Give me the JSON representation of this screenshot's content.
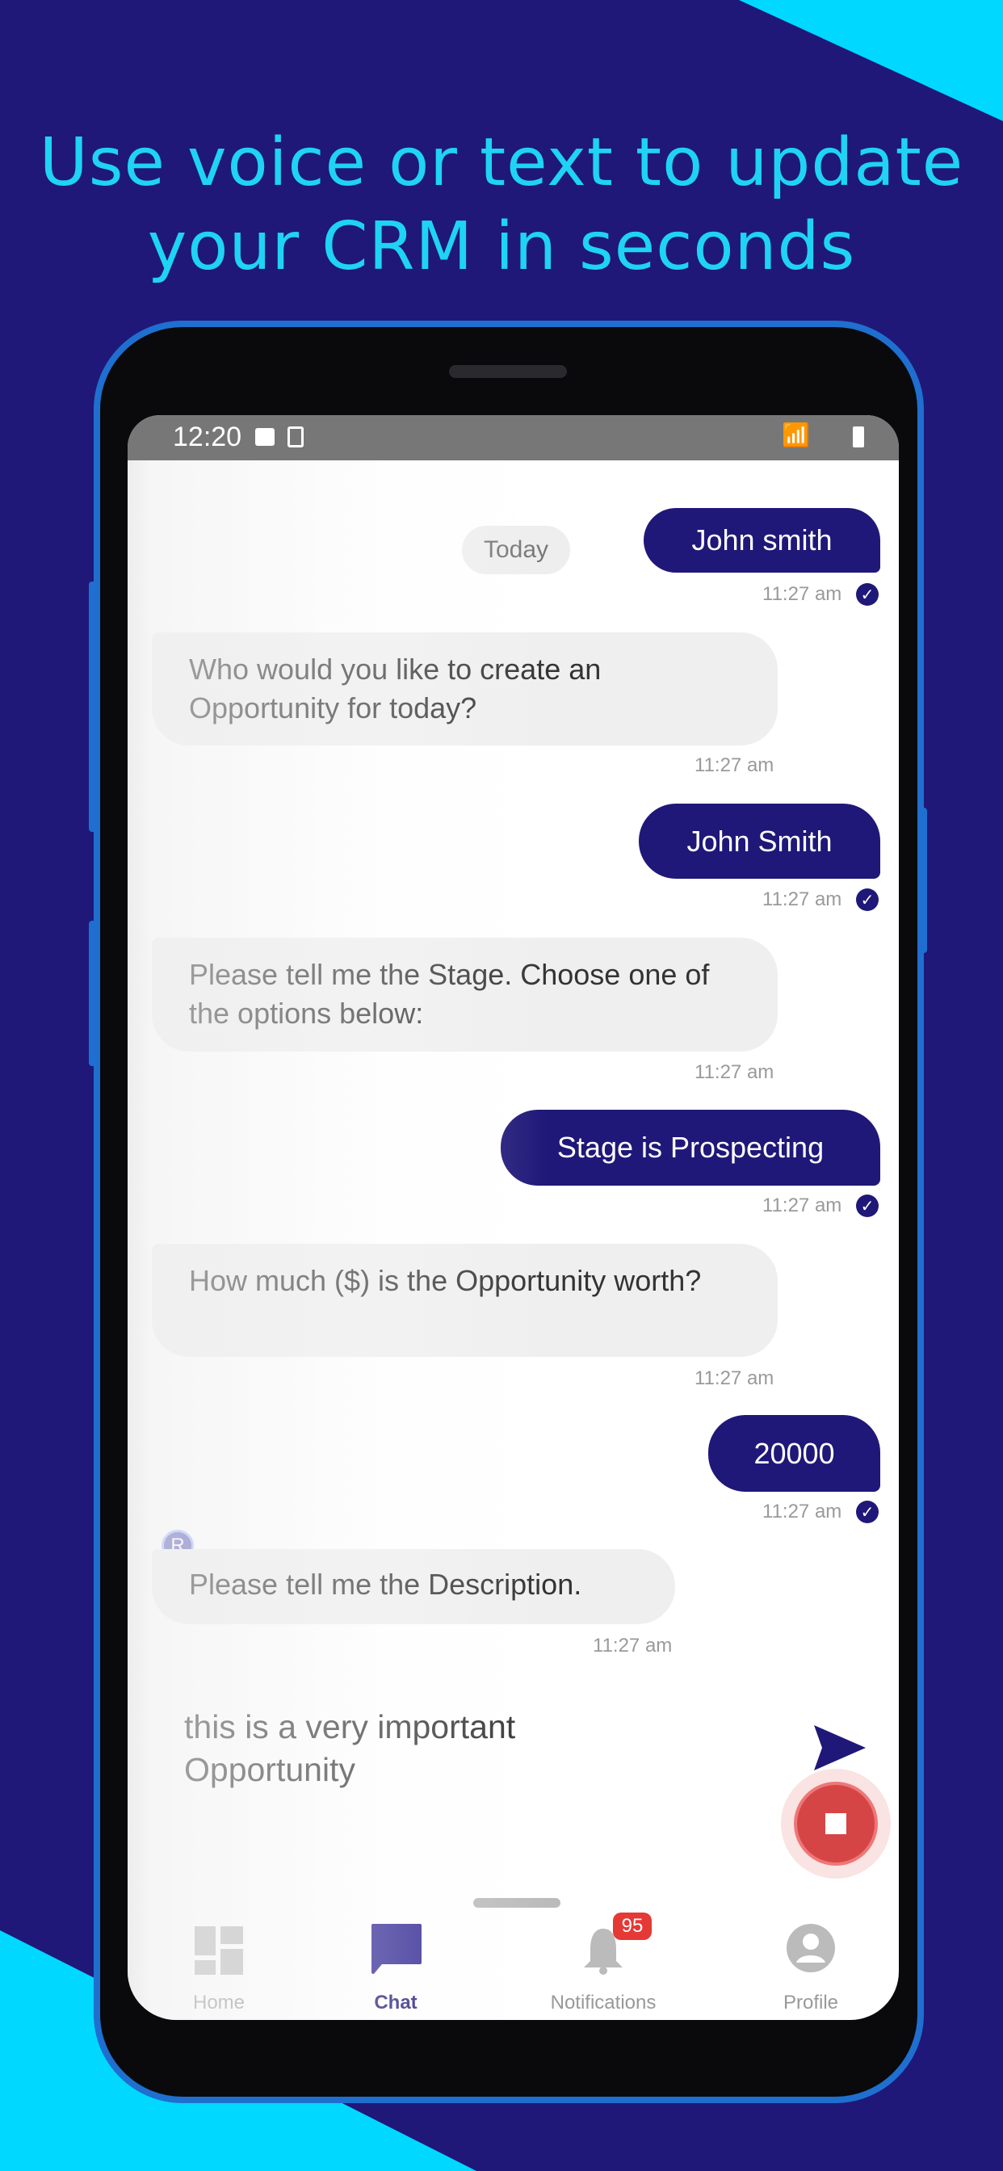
{
  "headline": {
    "line1": "Use voice or text to update",
    "line2": "your CRM in seconds"
  },
  "colors": {
    "background": "#1f1878",
    "accent": "#1fd3f5",
    "bubble_out": "#1f1878",
    "bubble_in": "#efefef",
    "record": "#d64545"
  },
  "status_bar": {
    "time": "12:20"
  },
  "chat": {
    "date_pill": "Today",
    "messages": [
      {
        "from": "user",
        "text": "John smith",
        "time": "11:27 am"
      },
      {
        "from": "bot",
        "text": "Who would you like to create an Opportunity for today?",
        "time": "11:27 am"
      },
      {
        "from": "user",
        "text": "John Smith",
        "time": "11:27 am"
      },
      {
        "from": "bot",
        "text": "Please tell me the Stage. Choose one of the options below:",
        "time": "11:27 am"
      },
      {
        "from": "user",
        "text": "Stage is Prospecting",
        "time": "11:27 am"
      },
      {
        "from": "bot",
        "text": "How much ($) is the Opportunity worth?",
        "time": "11:27 am"
      },
      {
        "from": "user",
        "text": "20000",
        "time": "11:27 am"
      },
      {
        "from": "bot",
        "text": "Please tell me the Description.",
        "time": "11:27 am"
      }
    ],
    "bot_avatar": "R",
    "input_value": "this is a very important Opportunity"
  },
  "nav": {
    "items": [
      {
        "label": "Home",
        "icon": "dashboard-icon"
      },
      {
        "label": "Chat",
        "icon": "chat-icon",
        "active": true
      },
      {
        "label": "Notifications",
        "icon": "bell-icon",
        "badge": "95"
      },
      {
        "label": "Profile",
        "icon": "profile-icon"
      }
    ]
  }
}
